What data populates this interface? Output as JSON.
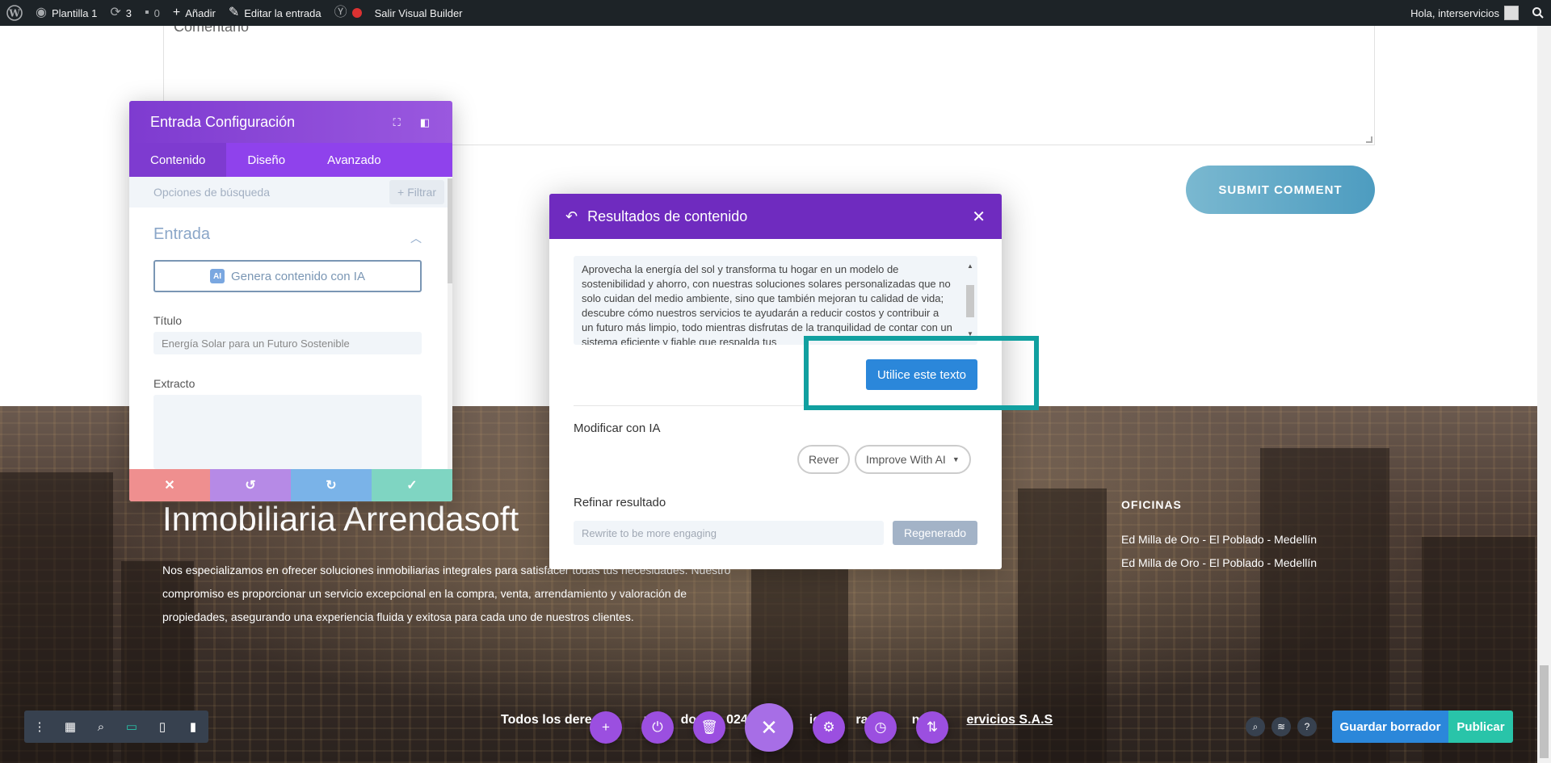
{
  "adminbar": {
    "site_name": "Plantilla 1",
    "updates_count": "3",
    "comments_count": "0",
    "add_label": "Añadir",
    "edit_label": "Editar la entrada",
    "exit_label": "Salir Visual Builder",
    "greeting": "Hola, interservicios"
  },
  "page": {
    "comment_placeholder": "Comentario",
    "submit_label": "SUBMIT COMMENT"
  },
  "footer": {
    "title": "Inmobiliaria Arrendasoft",
    "description": "Nos especializamos en ofrecer soluciones inmobiliarias integrales para satisfacer todas tus necesidades. Nuestro compromiso es proporcionar un servicio excepcional en la compra, venta, arrendamiento y valoración de propiedades, asegurando una experiencia fluida y exitosa para cada uno de nuestros clientes.",
    "offices_title": "OFICINAS",
    "offices": [
      "Ed Milla de Oro - El Poblado - Medellín",
      "Ed Milla de Oro - El Poblado - Medellín"
    ],
    "copyright_prefix": "Todos los dere",
    "copyright_mid1": "res",
    "copyright_mid2": "dos",
    "copyright_mid3": "024",
    "copyright_mid4": "io y",
    "copyright_mid5": "ram",
    "copyright_mid6": "n:",
    "copyright_link1": "In",
    "copyright_link2": "ervicios S.A.S"
  },
  "settings": {
    "title": "Entrada Configuración",
    "tabs": [
      "Contenido",
      "Diseño",
      "Avanzado"
    ],
    "search_placeholder": "Opciones de búsqueda",
    "filter_label": "Filtrar",
    "section": "Entrada",
    "ai_badge": "AI",
    "generate_label": "Genera contenido con IA",
    "title_label": "Título",
    "title_value": "Energía Solar para un Futuro Sostenible",
    "excerpt_label": "Extracto"
  },
  "ai_modal": {
    "title": "Resultados de contenido",
    "result_text": "Aprovecha la energía del sol y transforma tu hogar en un modelo de sostenibilidad y ahorro, con nuestras soluciones solares personalizadas que no solo cuidan del medio ambiente, sino que también mejoran tu calidad de vida; descubre cómo nuestros servicios te ayudarán a reducir costos y contribuir a un futuro más limpio, todo mientras disfrutas de la tranquilidad de contar con un sistema eficiente y fiable que respalda tus",
    "use_text_label": "Utilice este texto",
    "modify_label": "Modificar con IA",
    "revert_label": "Rever",
    "improve_label": "Improve With AI",
    "refine_label": "Refinar resultado",
    "refine_placeholder": "Rewrite to be more engaging",
    "regen_label": "Regenerado"
  },
  "builder": {
    "save_draft": "Guardar borrador",
    "publish": "Publicar"
  },
  "colors": {
    "purple": "#7e3bd0",
    "blue": "#2b87da",
    "teal": "#29c4a9",
    "highlight": "#11a0a0"
  }
}
